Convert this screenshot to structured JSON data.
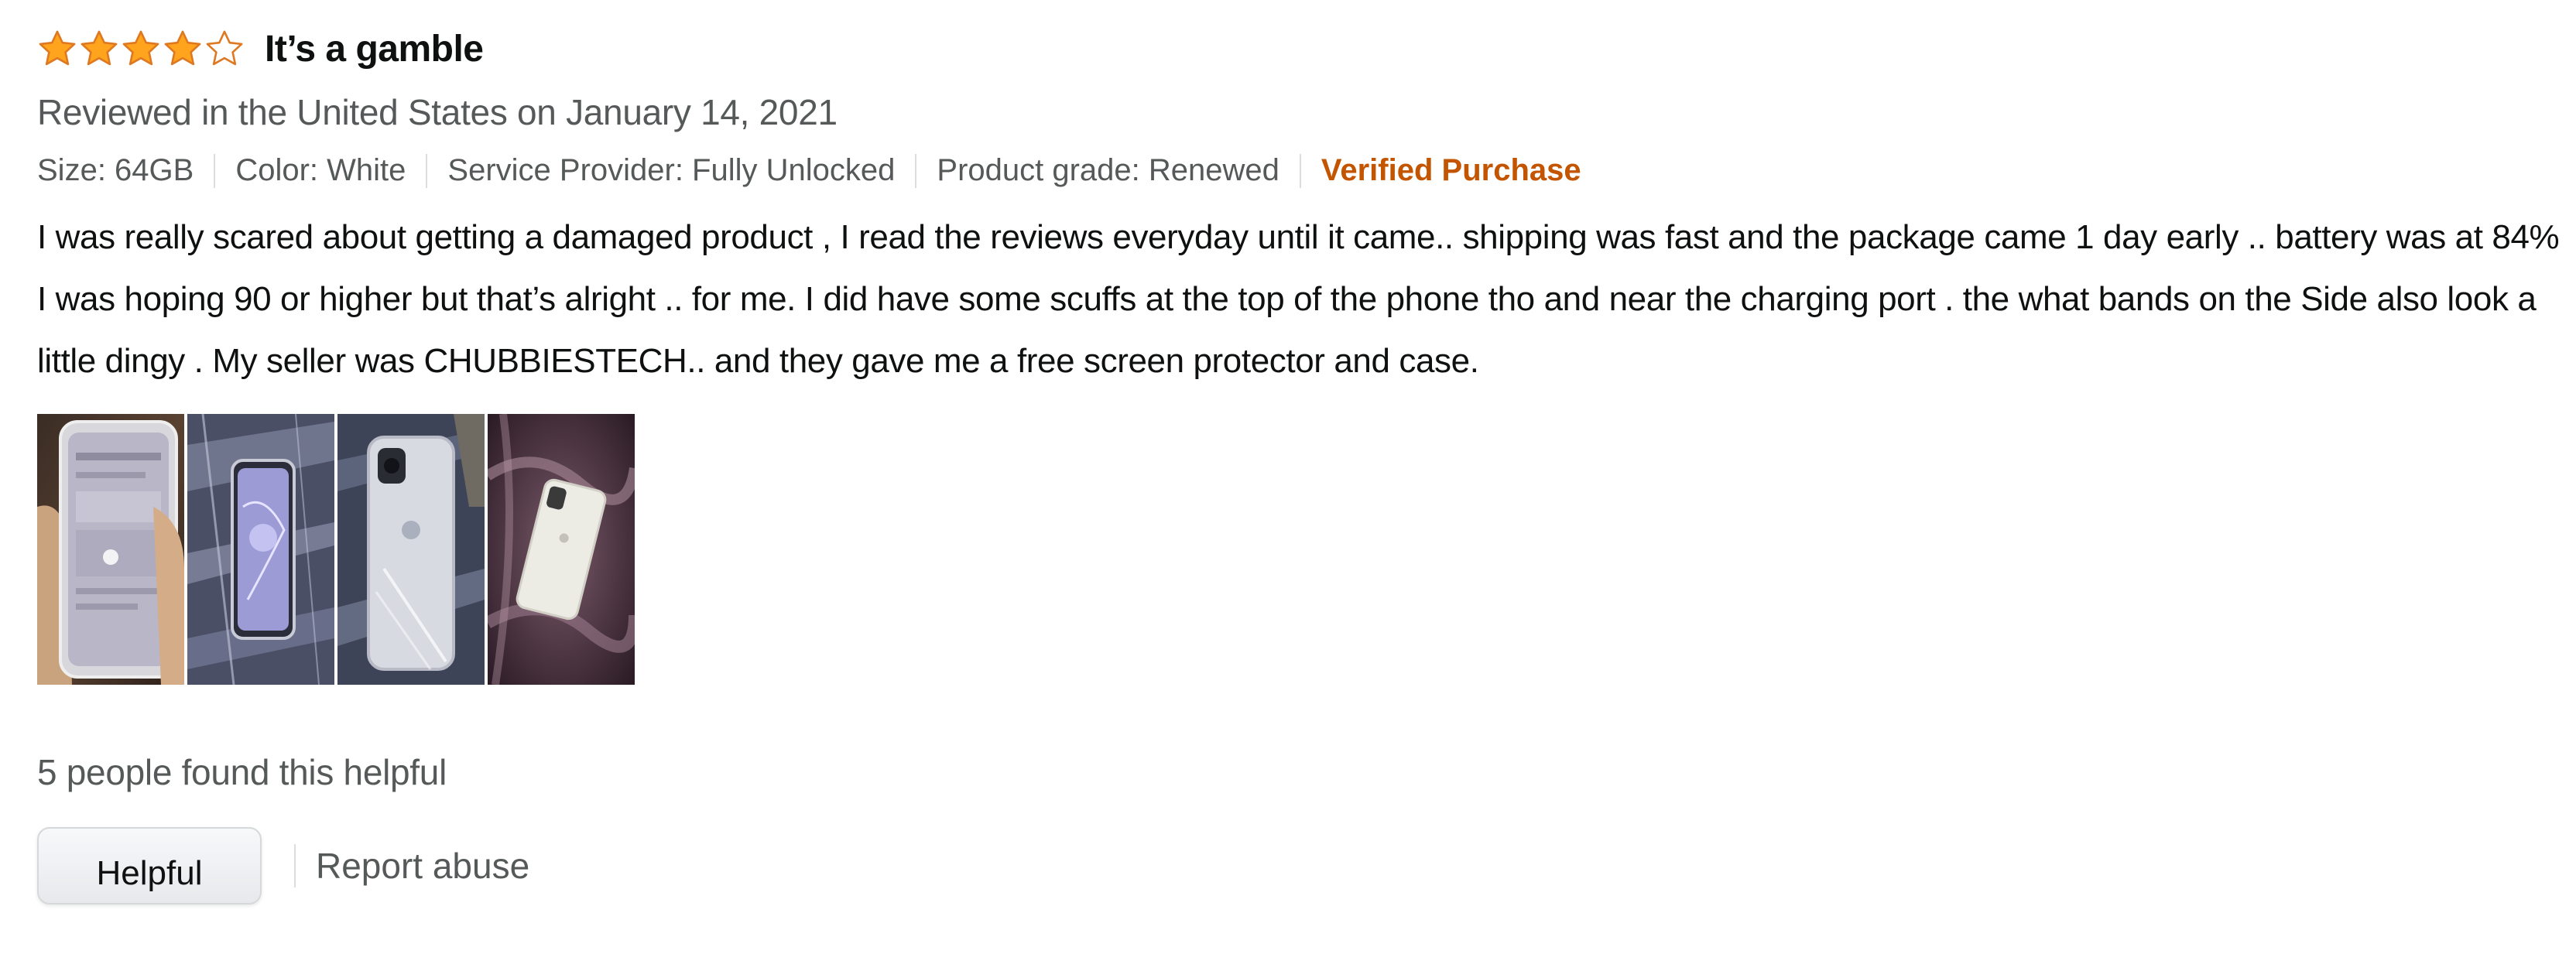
{
  "review": {
    "rating": 4,
    "max_rating": 5,
    "title": "It’s a gamble",
    "date_line": "Reviewed in the United States on January 14, 2021",
    "attributes": {
      "size": "Size: 64GB",
      "color": "Color: White",
      "service_provider": "Service Provider: Fully Unlocked",
      "product_grade": "Product grade: Renewed"
    },
    "verified_label": "Verified Purchase",
    "body": "I was really scared about getting a damaged product , I read the reviews everyday until it came.. shipping was fast and the package came 1 day early .. battery was at 84% I was hoping 90 or higher but that’s alright .. for me. I did have some scuffs at the top of the phone tho and near the charging port . the what bands on the Side also look a little dingy . My seller was CHUBBIESTECH.. and they gave me a free screen protector and case.",
    "image_count": 4,
    "helpful_count_text": "5 people found this helpful",
    "helpful_button_label": "Helpful",
    "report_label": "Report abuse"
  },
  "colors": {
    "star_fill": "#ffa41c",
    "star_stroke": "#de7921",
    "verified": "#c45500",
    "meta_text": "#565959"
  },
  "icons": {
    "star_full": "star-full-icon",
    "star_empty": "star-empty-icon"
  }
}
